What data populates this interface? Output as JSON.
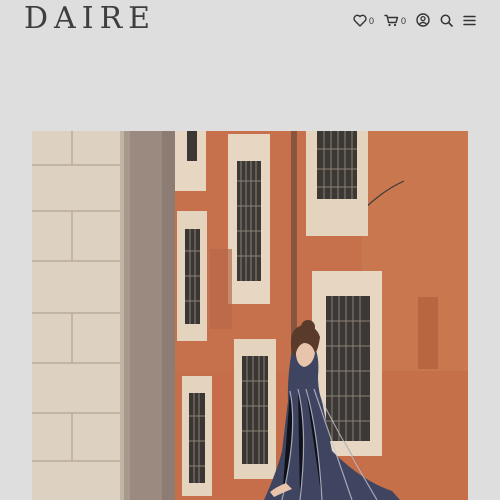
{
  "header": {
    "logo": "DAIRE",
    "wishlist_count": "0",
    "cart_count": "0"
  },
  "icons": [
    "heart-icon",
    "cart-icon",
    "account-icon",
    "search-icon",
    "menu-icon"
  ],
  "colors": {
    "background": "#dedede",
    "text": "#3e3e3e",
    "wall": "#c8734f",
    "stone": "#ddd2c2"
  }
}
